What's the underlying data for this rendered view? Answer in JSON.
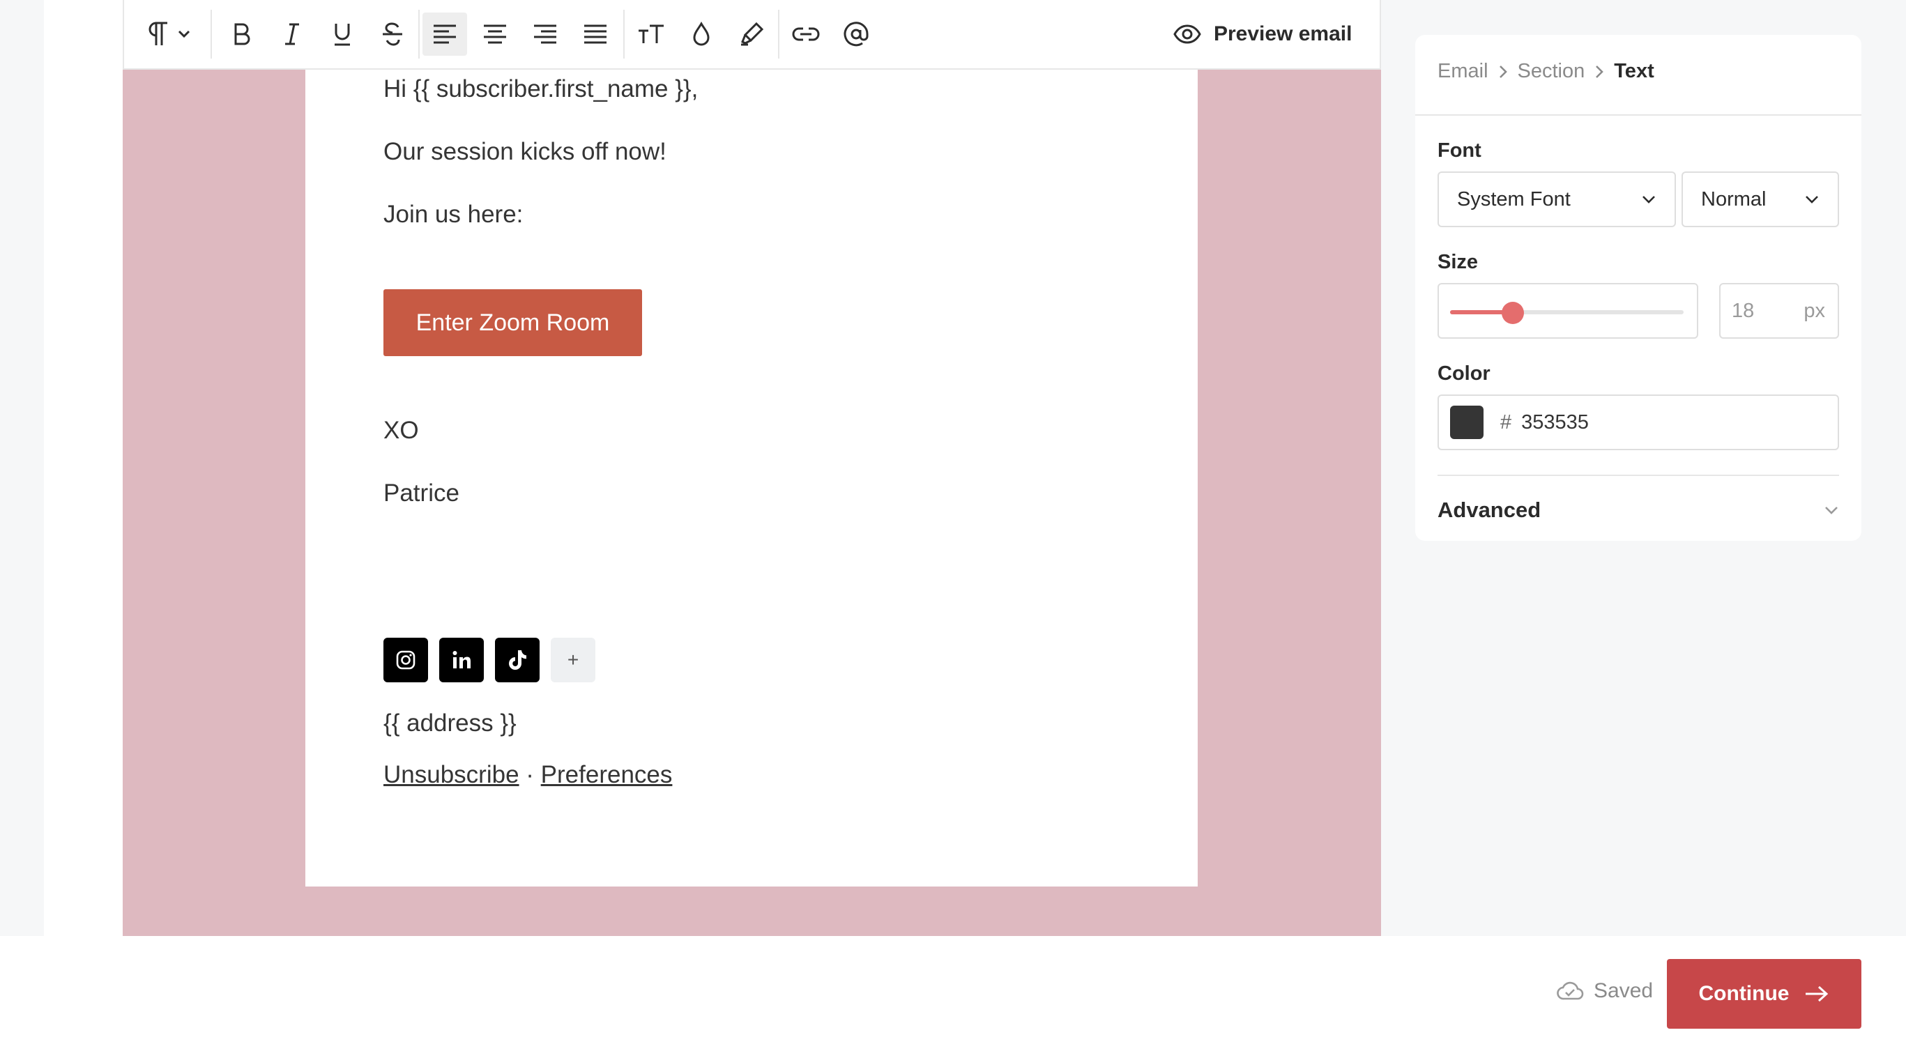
{
  "toolbar": {
    "items": [
      "paragraph-dropdown",
      "bold",
      "italic",
      "underline",
      "strikethrough",
      "align-left",
      "align-center",
      "align-right",
      "align-justify",
      "text-size",
      "text-color",
      "highlight",
      "link",
      "mention"
    ],
    "active_item": "align-left",
    "preview_label": "Preview email"
  },
  "email": {
    "background_color": "#deb9c0",
    "greeting": "Hi {{ subscriber.first_name }},",
    "line1": "Our session kicks off now!",
    "line2": "Join us here:",
    "cta_label": "Enter Zoom Room",
    "cta_color": "#c75a44",
    "signoff": "XO",
    "signature": "Patrice",
    "social_icons": [
      "instagram-icon",
      "linkedin-icon",
      "tiktok-icon"
    ],
    "add_social_label": "+",
    "address": "{{ address }}",
    "unsubscribe": "Unsubscribe",
    "separator": "·",
    "preferences": "Preferences"
  },
  "panel": {
    "breadcrumb": [
      "Email",
      "Section",
      "Text"
    ],
    "font_label": "Font",
    "font_family": "System Font",
    "font_weight": "Normal",
    "size_label": "Size",
    "size_value": "18",
    "size_unit": "px",
    "size_slider_fraction": 0.27,
    "color_label": "Color",
    "color_hash": "#",
    "color_hex": "353535",
    "color_swatch": "#353535",
    "advanced_label": "Advanced"
  },
  "footer": {
    "saved_label": "Saved",
    "continue_label": "Continue",
    "continue_color": "#c74749"
  }
}
